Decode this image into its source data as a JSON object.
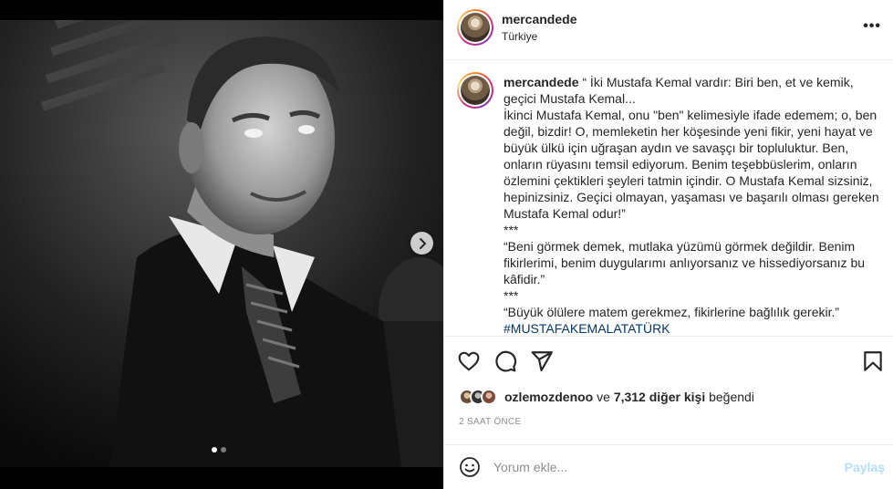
{
  "post": {
    "username": "mercandede",
    "location": "Türkiye",
    "more_label": "•••",
    "caption": {
      "username": "mercandede",
      "body": " “ İki Mustafa Kemal vardır: Biri ben, et ve kemik, geçici Mustafa Kemal...\nİkinci Mustafa Kemal, onu \"ben\" kelimesiyle ifade edemem; o, ben değil, bizdir! O, memleketin her köşesinde yeni fikir, yeni hayat ve büyük ülkü için uğraşan aydın ve savaşçı bir topluluktur. Ben, onların rüyasını temsil ediyorum. Benim teşebbüslerim, onların özlemini çektikleri şeyleri tatmin içindir. O Mustafa Kemal sizsiniz, hepinizsiniz. Geçici olmayan, yaşaması ve başarılı olması gereken Mustafa Kemal odur!”\n***\n“Beni görmek demek, mutlaka yüzümü görmek değildir. Benim fikirlerimi, benim duygularımı anlıyorsanız ve hissediyorsanız bu kâfidir.”\n***\n“Büyük ölülere matem gerekmez, fikirlerine bağlılık gerekir.”\n",
      "hashtag": "#MUSTAFAKEMALATATÜRK"
    },
    "likes": {
      "first_user": "ozlemozdenoo",
      "connector": " ve ",
      "others": "7,312 diğer kişi",
      "suffix": " beğendi"
    },
    "time_ago": "2 SAAT ÖNCE",
    "comment_placeholder": "Yorum ekle...",
    "post_button": "Paylaş",
    "carousel": {
      "total": 2,
      "current": 1
    }
  },
  "icons": {
    "like": "heart-outline-icon",
    "comment": "speech-bubble-icon",
    "share": "paper-plane-icon",
    "save": "bookmark-icon",
    "next": "chevron-right-icon",
    "emoji": "smiley-icon"
  },
  "colors": {
    "text": "#262626",
    "muted": "#8e8e8e",
    "hashtag": "#00376b",
    "post_button_disabled": "#b2dffc"
  }
}
